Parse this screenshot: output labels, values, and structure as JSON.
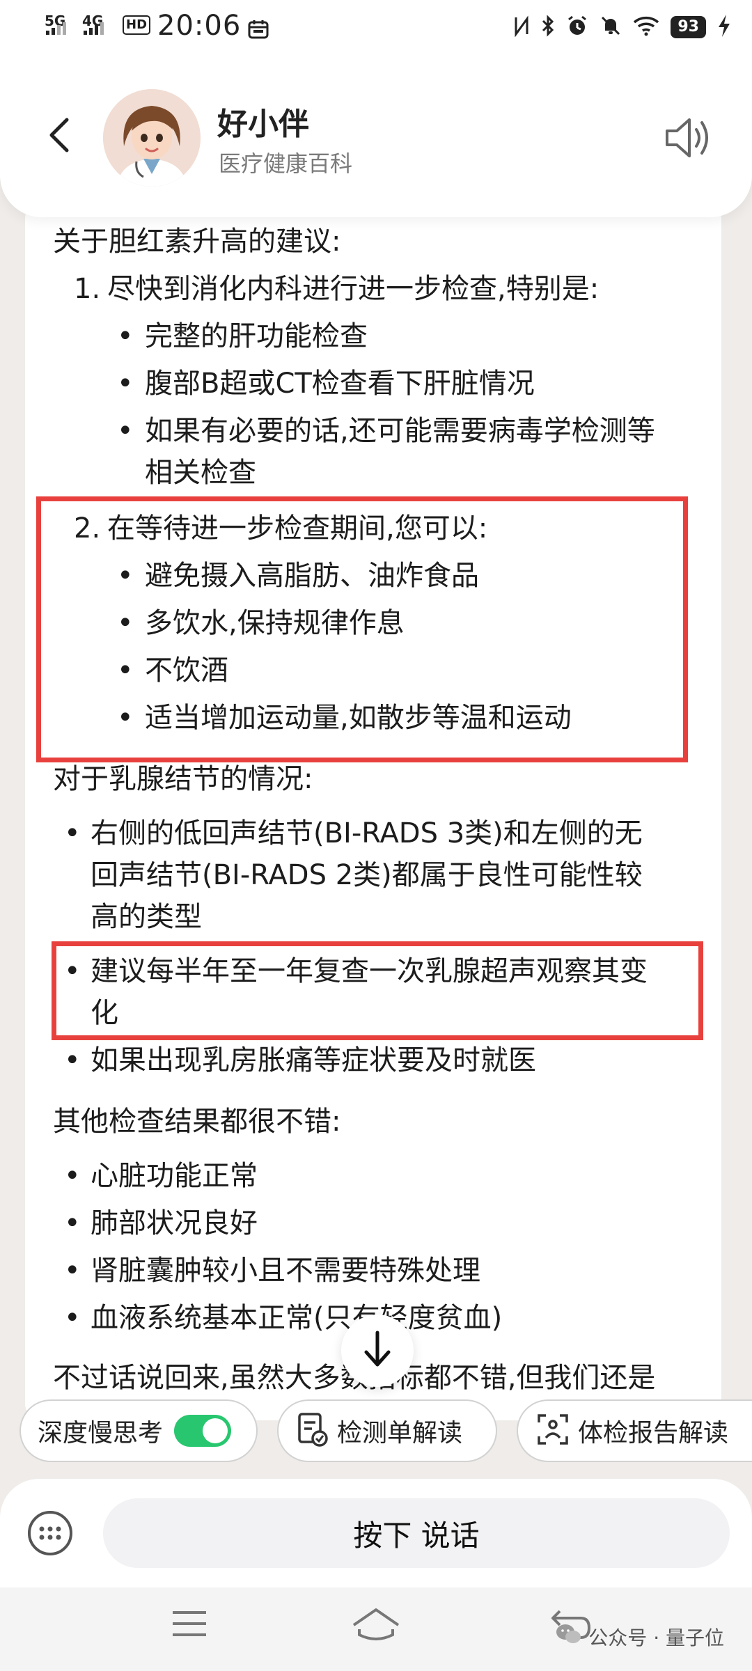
{
  "status_bar": {
    "net1": "5G",
    "net2": "4G",
    "hd": "HD",
    "time": "20:06",
    "battery": "93"
  },
  "header": {
    "name": "好小伴",
    "subtitle": "医疗健康百科"
  },
  "message": {
    "bilirubin_heading": "关于胆红素升高的建议:",
    "bilirubin_items": [
      {
        "number": "1.",
        "text": "尽快到消化内科进行进一步检查,特别是:",
        "bullets": [
          "完整的肝功能检查",
          "腹部B超或CT检查看下肝脏情况",
          [
            "如果有必要的话,还可能需要病毒学检测等",
            "相关检查"
          ]
        ]
      },
      {
        "number": "2.",
        "text": "在等待进一步检查期间,您可以:",
        "bullets": [
          "避免摄入高脂肪、油炸食品",
          "多饮水,保持规律作息",
          "不饮酒",
          "适当增加运动量,如散步等温和运动"
        ]
      }
    ],
    "breast_heading": "对于乳腺结节的情况:",
    "breast_bullets": [
      [
        "右侧的低回声结节(BI-RADS 3类)和左侧的无",
        "回声结节(BI-RADS 2类)都属于良性可能性较",
        "高的类型"
      ],
      [
        "建议每半年至一年复查一次乳腺超声观察其变",
        "化"
      ],
      [
        "如果出现乳房胀痛等症状要及时就医"
      ]
    ],
    "other_heading": "其他检查结果都很不错:",
    "other_bullets": [
      "心脏功能正常",
      "肺部状况良好",
      "肾脏囊肿较小且不需要特殊处理",
      "血液系统基本正常(只有轻度贫血)"
    ],
    "closing_partial": "不过话说回来,虽然大多数指标都不错,但我们还是"
  },
  "chips": {
    "deep_think": "深度慢思考",
    "test_sheet": "检测单解读",
    "checkup_report": "体检报告解读"
  },
  "input": {
    "voice_label": "按下 说话"
  },
  "watermark": {
    "text": "公众号 · 量子位"
  },
  "colors": {
    "highlight": "#e8413d",
    "toggle_on": "#28c76f"
  }
}
